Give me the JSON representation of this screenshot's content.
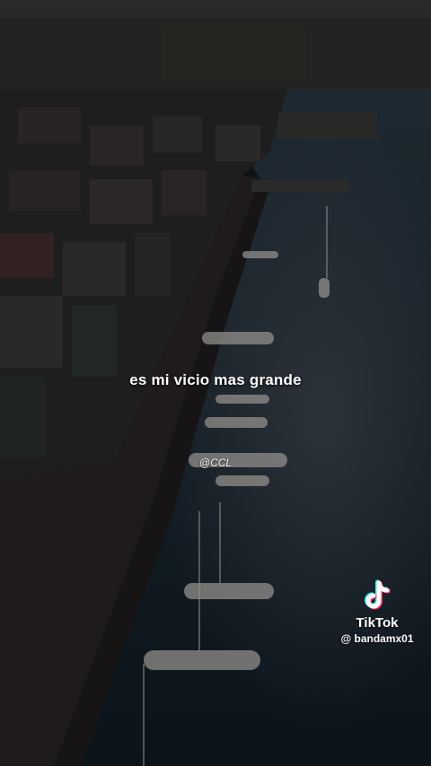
{
  "video": {
    "caption": "es mi vicio mas grande",
    "overlay_handle": "@CCL"
  },
  "watermark": {
    "icon": "tiktok-logo-icon",
    "brand": "TikTok",
    "username": "@ bandamx01"
  },
  "colors": {
    "water": "#1b2a36",
    "quay": "#2a2526",
    "buildings": "#2f2b2d"
  }
}
